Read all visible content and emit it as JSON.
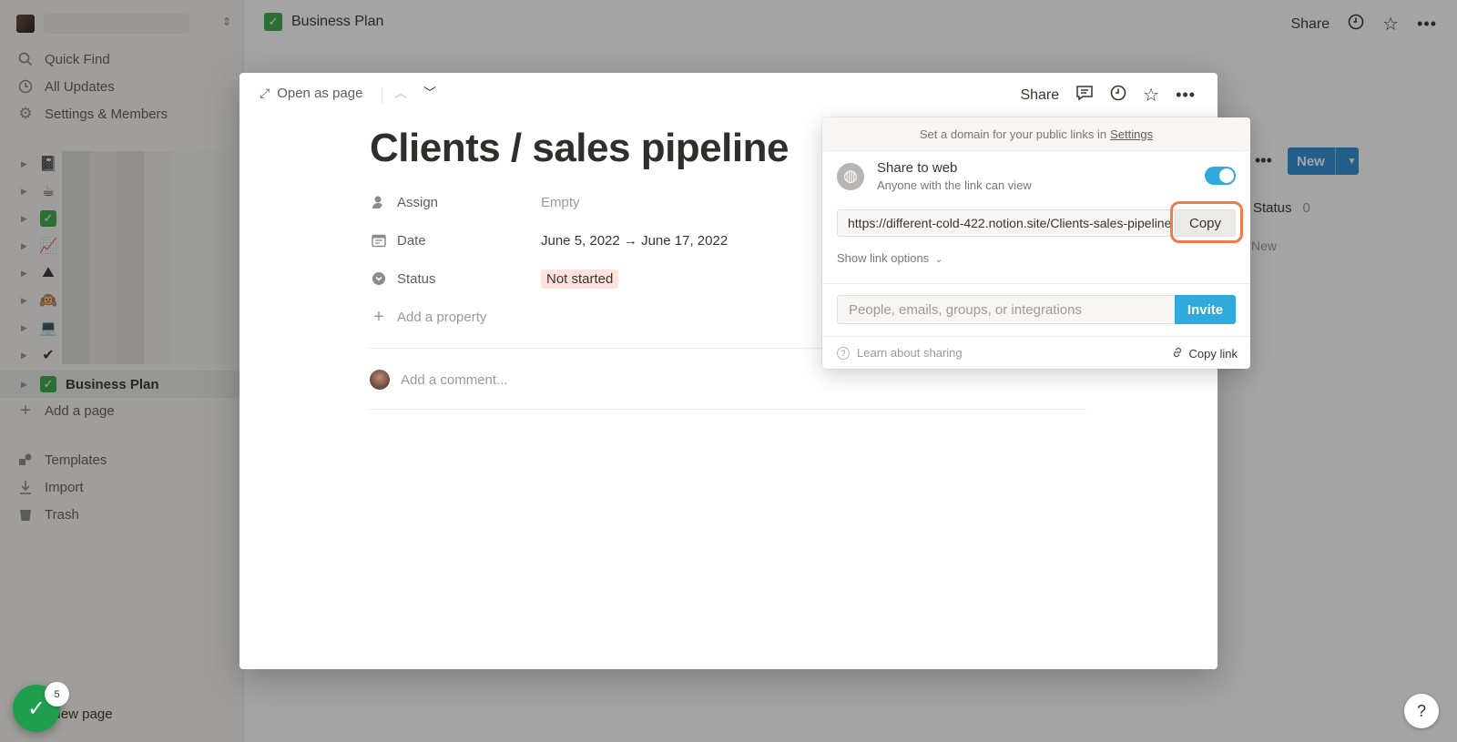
{
  "sidebar": {
    "nav": [
      {
        "label": "Quick Find",
        "icon": "search-icon"
      },
      {
        "label": "All Updates",
        "icon": "clock-icon"
      },
      {
        "label": "Settings & Members",
        "icon": "gear-icon"
      }
    ],
    "tree_emojis": [
      "📓",
      "☕",
      "✅",
      "📈",
      "⛰",
      "🙉",
      "💻",
      "✔"
    ],
    "active_page": {
      "emoji": "✅",
      "label": "Business Plan"
    },
    "add_page": "Add a page",
    "bottom_nav": [
      {
        "label": "Templates",
        "icon": "templates-icon"
      },
      {
        "label": "Import",
        "icon": "import-icon"
      },
      {
        "label": "Trash",
        "icon": "trash-icon"
      }
    ],
    "new_page": "New page"
  },
  "topbar": {
    "breadcrumb": "Business Plan",
    "share": "Share"
  },
  "background": {
    "new_button": "New",
    "status_label": "Status",
    "status_count": "0",
    "new_link": "New"
  },
  "modal": {
    "open_as_page": "Open as page",
    "share": "Share",
    "title": "Clients / sales pipeline",
    "properties": [
      {
        "name": "Assign",
        "value": "Empty",
        "icon": "person-icon"
      },
      {
        "name": "Date",
        "value": "June 5, 2022 → June 17, 2022",
        "icon": "calendar-icon"
      },
      {
        "name": "Status",
        "value": "Not started",
        "icon": "status-icon"
      }
    ],
    "add_property": "Add a property",
    "add_comment": "Add a comment..."
  },
  "share_popover": {
    "domain_notice": "Set a domain for your public links in",
    "domain_link": "Settings",
    "share_to_web_title": "Share to web",
    "share_to_web_subtitle": "Anyone with the link can view",
    "toggle_on": true,
    "url": "https://different-cold-422.notion.site/Clients-sales-pipeline",
    "copy": "Copy",
    "show_link_options": "Show link options",
    "invite_placeholder": "People, emails, groups, or integrations",
    "invite": "Invite",
    "learn": "Learn about sharing",
    "copy_link": "Copy link"
  },
  "fab": {
    "badge": "5"
  },
  "help": "?",
  "colors": {
    "accent": "#2eaadc",
    "highlight": "#ef7b4a",
    "status_tag_bg": "#fde2dd",
    "check_green": "#3ea84a"
  }
}
